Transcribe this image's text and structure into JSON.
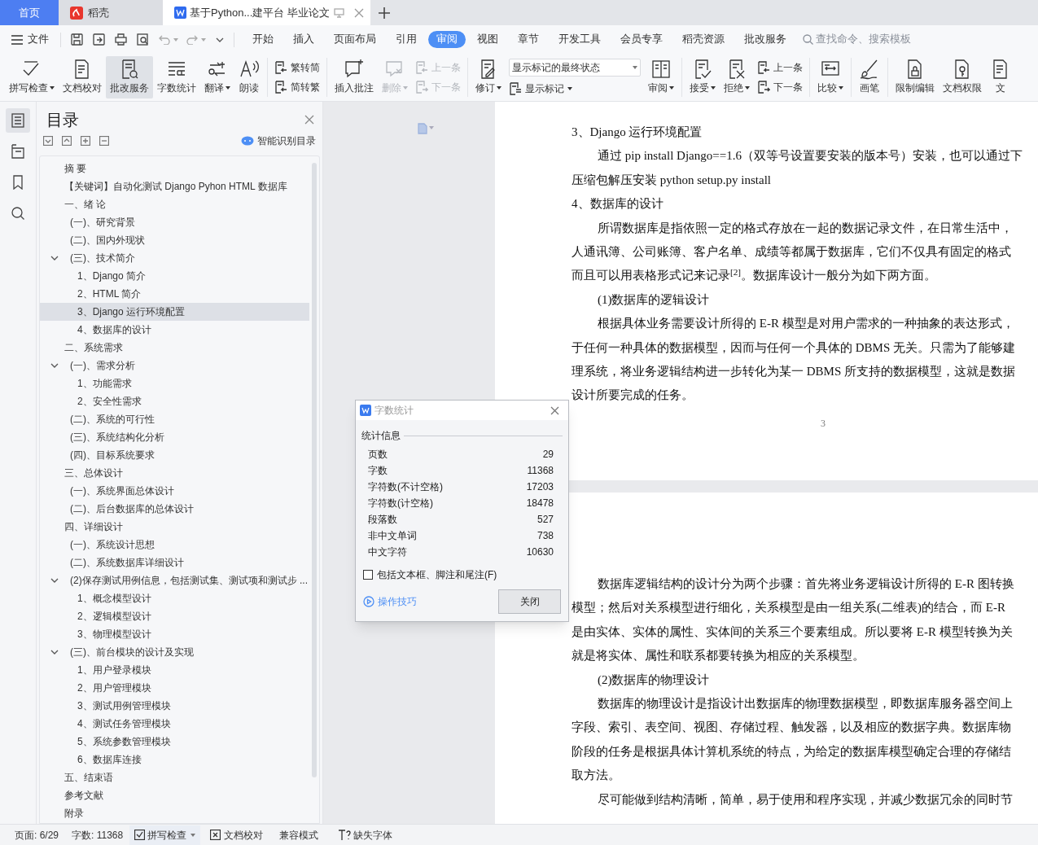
{
  "tabs": [
    {
      "kind": "home",
      "label": "首页",
      "selected": false
    },
    {
      "kind": "app",
      "label": "稻壳",
      "selected": false
    },
    {
      "kind": "document",
      "label": "基于Python...建平台 毕业论文",
      "selected": true
    }
  ],
  "menu": {
    "file": "文件",
    "tabs": [
      {
        "label": "开始",
        "selected": false
      },
      {
        "label": "插入",
        "selected": false
      },
      {
        "label": "页面布局",
        "selected": false
      },
      {
        "label": "引用",
        "selected": false
      },
      {
        "label": "审阅",
        "selected": true
      },
      {
        "label": "视图",
        "selected": false
      },
      {
        "label": "章节",
        "selected": false
      },
      {
        "label": "开发工具",
        "selected": false
      },
      {
        "label": "会员专享",
        "selected": false
      },
      {
        "label": "稻壳资源",
        "selected": false
      },
      {
        "label": "批改服务",
        "selected": false
      }
    ],
    "search": {
      "placeholder": "查找命令、搜索模板"
    }
  },
  "ribbon": [
    {
      "kind": "large",
      "label": "拼写检查",
      "dropdown": true,
      "active": false,
      "disabled": false
    },
    {
      "kind": "large",
      "label": "文档校对",
      "dropdown": false,
      "active": false,
      "disabled": false
    },
    {
      "kind": "large",
      "label": "批改服务",
      "dropdown": false,
      "active": true,
      "disabled": false
    },
    {
      "kind": "large",
      "label": "字数统计",
      "dropdown": false,
      "active": false,
      "disabled": false
    },
    {
      "kind": "large",
      "label": "翻译",
      "dropdown": true,
      "active": false,
      "disabled": false
    },
    {
      "kind": "large",
      "label": "朗读",
      "dropdown": false,
      "active": false,
      "disabled": false
    },
    {
      "kind": "separator"
    },
    {
      "kind": "pair",
      "items": [
        {
          "label": "繁转简",
          "disabled": false
        },
        {
          "label": "简转繁",
          "disabled": false
        }
      ]
    },
    {
      "kind": "separator"
    },
    {
      "kind": "large",
      "label": "插入批注",
      "dropdown": false,
      "active": false,
      "disabled": false
    },
    {
      "kind": "large",
      "label": "删除",
      "dropdown": true,
      "active": false,
      "disabled": true
    },
    {
      "kind": "pair",
      "items": [
        {
          "label": "上一条",
          "disabled": true
        },
        {
          "label": "下一条",
          "disabled": true
        }
      ]
    },
    {
      "kind": "separator"
    },
    {
      "kind": "large",
      "label": "修订",
      "dropdown": true,
      "active": false,
      "disabled": false
    },
    {
      "kind": "select",
      "value": "显示标记的最终状态",
      "below": {
        "label": "显示标记",
        "dropdown": true
      }
    },
    {
      "kind": "large",
      "label": "审阅",
      "dropdown": true,
      "active": false,
      "disabled": false
    },
    {
      "kind": "separator"
    },
    {
      "kind": "large",
      "label": "接受",
      "dropdown": true,
      "active": false,
      "disabled": false
    },
    {
      "kind": "large",
      "label": "拒绝",
      "dropdown": true,
      "active": false,
      "disabled": false
    },
    {
      "kind": "pair",
      "items": [
        {
          "label": "上一条",
          "disabled": false
        },
        {
          "label": "下一条",
          "disabled": false
        }
      ]
    },
    {
      "kind": "separator"
    },
    {
      "kind": "large",
      "label": "比较",
      "dropdown": true,
      "active": false,
      "disabled": false
    },
    {
      "kind": "separator"
    },
    {
      "kind": "large",
      "label": "画笔",
      "dropdown": false,
      "active": false,
      "disabled": false
    },
    {
      "kind": "separator"
    },
    {
      "kind": "large",
      "label": "限制编辑",
      "dropdown": false,
      "active": false,
      "disabled": false
    },
    {
      "kind": "large",
      "label": "文档权限",
      "dropdown": false,
      "active": false,
      "disabled": false
    },
    {
      "kind": "large",
      "label": "文",
      "dropdown": false,
      "active": false,
      "disabled": false
    }
  ],
  "rail": [
    {
      "selected": true
    },
    {
      "selected": false
    },
    {
      "selected": false
    },
    {
      "selected": false
    }
  ],
  "sidebar": {
    "title": "目录",
    "smart_button": "智能识别目录",
    "toc": [
      {
        "label": "摘  要",
        "selected": false
      },
      {
        "label": "【关键词】自动化测试 Django Pyhon HTML 数据库",
        "selected": false
      },
      {
        "label": "一、绪  论",
        "selected": false,
        "children": [
          {
            "label": "(一)、研究背景",
            "selected": false
          },
          {
            "label": "(二)、国内外现状",
            "selected": false
          },
          {
            "label": "(三)、技术简介",
            "selected": false,
            "expanded": true,
            "children": [
              {
                "label": "1、Django 简介",
                "selected": false
              },
              {
                "label": "2、HTML 简介",
                "selected": false
              },
              {
                "label": "3、Django 运行环境配置",
                "selected": true
              },
              {
                "label": "4、数据库的设计",
                "selected": false
              }
            ]
          }
        ]
      },
      {
        "label": "二、系统需求",
        "selected": false,
        "children": [
          {
            "label": "(一)、需求分析",
            "selected": false,
            "expanded": true,
            "children": [
              {
                "label": "1、功能需求",
                "selected": false
              },
              {
                "label": "2、安全性需求",
                "selected": false
              }
            ]
          },
          {
            "label": "(二)、系统的可行性",
            "selected": false
          },
          {
            "label": "(三)、系统结构化分析",
            "selected": false
          },
          {
            "label": "(四)、目标系统要求",
            "selected": false
          }
        ]
      },
      {
        "label": "三、总体设计",
        "selected": false,
        "children": [
          {
            "label": "(一)、系统界面总体设计",
            "selected": false
          },
          {
            "label": "(二)、后台数据库的总体设计",
            "selected": false
          }
        ]
      },
      {
        "label": "四、详细设计",
        "selected": false,
        "children": [
          {
            "label": "(一)、系统设计思想",
            "selected": false
          },
          {
            "label": "(二)、系统数据库详细设计",
            "selected": false
          },
          {
            "label": "(2)保存测试用例信息，包括测试集、测试项和测试步 ...",
            "selected": false,
            "expanded": true,
            "children": [
              {
                "label": "1、概念模型设计",
                "selected": false
              },
              {
                "label": "2、逻辑模型设计",
                "selected": false
              },
              {
                "label": "3、物理模型设计",
                "selected": false
              }
            ]
          },
          {
            "label": "(三)、前台模块的设计及实现",
            "selected": false,
            "expanded": true,
            "children": [
              {
                "label": "1、用户登录模块",
                "selected": false
              },
              {
                "label": "2、用户管理模块",
                "selected": false
              },
              {
                "label": "3、测试用例管理模块",
                "selected": false
              },
              {
                "label": "4、测试任务管理模块",
                "selected": false
              },
              {
                "label": "5、系统参数管理模块",
                "selected": false
              },
              {
                "label": "6、数据库连接",
                "selected": false
              }
            ]
          }
        ]
      },
      {
        "label": "五、结束语",
        "selected": false
      },
      {
        "label": "参考文献",
        "selected": false
      },
      {
        "label": "附录",
        "selected": false
      }
    ]
  },
  "document": {
    "pages": [
      {
        "page_number": "3",
        "lines": [
          {
            "kind": "heading",
            "text": "3、Django 运行环境配置"
          },
          {
            "kind": "indent",
            "text": "通过 pip install Django==1.6（双等号设置要安装的版本号）安装，也可以通过下"
          },
          {
            "kind": "plain",
            "text": "压缩包解压安装 python setup.py install"
          },
          {
            "kind": "heading",
            "text": "4、数据库的设计"
          },
          {
            "kind": "indent",
            "text": "所谓数据库是指依照一定的格式存放在一起的数据记录文件，在日常生活中，"
          },
          {
            "kind": "plain",
            "text": "人通讯簿、公司账簿、客户名单、成绩等都属于数据库，它们不仅具有固定的格式"
          },
          {
            "kind": "plain",
            "text": "而且可以用表格形式记来记录$^{[2]}$。数据库设计一般分为如下两方面。"
          },
          {
            "kind": "indent",
            "text": "(1)数据库的逻辑设计"
          },
          {
            "kind": "indent",
            "text": "根据具体业务需要设计所得的 E-R 模型是对用户需求的一种抽象的表达形式，"
          },
          {
            "kind": "plain",
            "text": "于任何一种具体的数据模型，因而与任何一个具体的 DBMS 无关。只需为了能够建"
          },
          {
            "kind": "plain",
            "text": "理系统，将业务逻辑结构进一步转化为某一 DBMS 所支持的数据模型，这就是数据"
          },
          {
            "kind": "plain",
            "text": "设计所要完成的任务。"
          }
        ]
      },
      {
        "lines": [
          {
            "kind": "indent",
            "text": "数据库逻辑结构的设计分为两个步骤：首先将业务逻辑设计所得的 E-R 图转换"
          },
          {
            "kind": "plain",
            "text": "模型；然后对关系模型进行细化，关系模型是由一组关系(二维表)的结合，而 E-R"
          },
          {
            "kind": "plain",
            "text": "是由实体、实体的属性、实体间的关系三个要素组成。所以要将 E-R 模型转换为关"
          },
          {
            "kind": "plain",
            "text": "就是将实体、属性和联系都要转换为相应的关系模型。"
          },
          {
            "kind": "indent",
            "text": "(2)数据库的物理设计"
          },
          {
            "kind": "indent",
            "text": "数据库的物理设计是指设计出数据库的物理数据模型，即数据库服务器空间上"
          },
          {
            "kind": "plain",
            "text": "字段、索引、表空间、视图、存储过程、触发器，以及相应的数据字典。数据库物"
          },
          {
            "kind": "plain",
            "text": "阶段的任务是根据具体计算机系统的特点，为给定的数据库模型确定合理的存储结"
          },
          {
            "kind": "plain",
            "text": "取方法。"
          },
          {
            "kind": "indent",
            "text": "尽可能做到结构清晰，简单，易于使用和程序实现，并减少数据冗余的同时节"
          }
        ]
      }
    ]
  },
  "dialog": {
    "title": "字数统计",
    "group": "统计信息",
    "stats": [
      {
        "label": "页数",
        "value": "29"
      },
      {
        "label": "字数",
        "value": "11368"
      },
      {
        "label": "字符数(不计空格)",
        "value": "17203"
      },
      {
        "label": "字符数(计空格)",
        "value": "18478"
      },
      {
        "label": "段落数",
        "value": "527"
      },
      {
        "label": "非中文单词",
        "value": "738"
      },
      {
        "label": "中文字符",
        "value": "10630"
      }
    ],
    "checkbox": {
      "label": "包括文本框、脚注和尾注(F)",
      "checked": false
    },
    "tips_link": "操作技巧",
    "close_button": "关闭"
  },
  "status_bar": [
    {
      "kind": "text",
      "label": "页面: 6/29"
    },
    {
      "kind": "text",
      "label": "字数: 11368"
    },
    {
      "kind": "check",
      "label": "拼写检查"
    },
    {
      "kind": "proof",
      "label": "文档校对"
    },
    {
      "kind": "text",
      "label": "兼容模式"
    },
    {
      "kind": "font",
      "label": "缺失字体"
    }
  ]
}
